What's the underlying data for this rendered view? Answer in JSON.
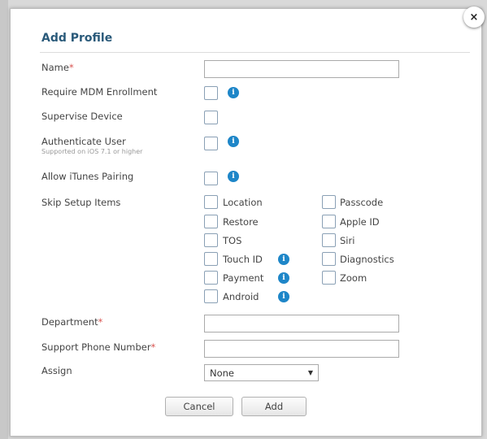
{
  "dialog": {
    "title": "Add Profile",
    "close_glyph": "×"
  },
  "fields": {
    "name": {
      "label": "Name",
      "required_mark": "*",
      "value": ""
    },
    "require_mdm": {
      "label": "Require MDM Enrollment",
      "checked": false
    },
    "supervise": {
      "label": "Supervise Device",
      "checked": false
    },
    "authenticate": {
      "label": "Authenticate User",
      "sublabel": "Supported on iOS 7.1 or higher",
      "checked": false
    },
    "itunes": {
      "label": "Allow iTunes Pairing",
      "checked": false
    },
    "skip_setup": {
      "label": "Skip Setup Items",
      "left_options": [
        "Location",
        "Restore",
        "TOS",
        "Touch ID",
        "Payment",
        "Android"
      ],
      "right_options": [
        "Passcode",
        "Apple ID",
        "Siri",
        "Diagnostics",
        "Zoom"
      ]
    },
    "department": {
      "label": "Department",
      "required_mark": "*",
      "value": ""
    },
    "support_phone": {
      "label": "Support Phone Number",
      "required_mark": "*",
      "value": ""
    },
    "assign": {
      "label": "Assign",
      "selected": "None"
    }
  },
  "actions": {
    "cancel_label": "Cancel",
    "add_label": "Add"
  },
  "icons": {
    "info": "info-icon",
    "info_glyph": "i",
    "caret": "▼"
  },
  "colors": {
    "title": "#2a5a7a",
    "required": "#d9534f",
    "info": "#1e86c8"
  }
}
